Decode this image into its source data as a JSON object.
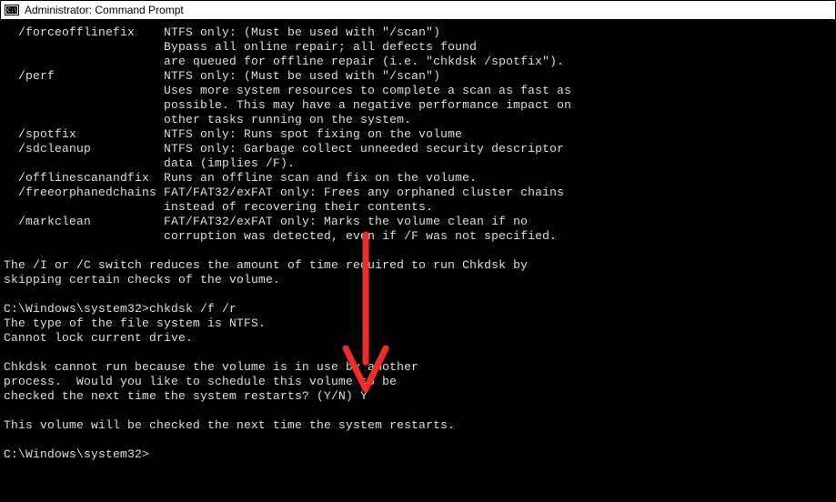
{
  "window": {
    "title": "Administrator: Command Prompt"
  },
  "help": {
    "opt_forceofflinefix": "  /forceofflinefix    NTFS only: (Must be used with \"/scan\")",
    "opt_forceofflinefix_l2": "                      Bypass all online repair; all defects found",
    "opt_forceofflinefix_l3": "                      are queued for offline repair (i.e. \"chkdsk /spotfix\").",
    "opt_perf": "  /perf               NTFS only: (Must be used with \"/scan\")",
    "opt_perf_l2": "                      Uses more system resources to complete a scan as fast as",
    "opt_perf_l3": "                      possible. This may have a negative performance impact on",
    "opt_perf_l4": "                      other tasks running on the system.",
    "opt_spotfix": "  /spotfix            NTFS only: Runs spot fixing on the volume",
    "opt_sdcleanup": "  /sdcleanup          NTFS only: Garbage collect unneeded security descriptor",
    "opt_sdcleanup_l2": "                      data (implies /F).",
    "opt_offlinescanandfix": "  /offlinescanandfix  Runs an offline scan and fix on the volume.",
    "opt_freeorphanedchains": "  /freeorphanedchains FAT/FAT32/exFAT only: Frees any orphaned cluster chains",
    "opt_freeorphanedchains_l2": "                      instead of recovering their contents.",
    "opt_markclean": "  /markclean          FAT/FAT32/exFAT only: Marks the volume clean if no",
    "opt_markclean_l2": "                      corruption was detected, even if /F was not specified.",
    "note_l1": "The /I or /C switch reduces the amount of time required to run Chkdsk by",
    "note_l2": "skipping certain checks of the volume."
  },
  "session": {
    "prompt1": "C:\\Windows\\system32>",
    "command1": "chkdsk /f /r",
    "out_fs_type": "The type of the file system is NTFS.",
    "out_cannot_lock": "Cannot lock current drive.",
    "out_inuse_l1": "Chkdsk cannot run because the volume is in use by another",
    "out_inuse_l2": "process.  Would you like to schedule this volume to be",
    "out_inuse_l3": "checked the next time the system restarts? (Y/N) ",
    "answer": "Y",
    "out_scheduled": "This volume will be checked the next time the system restarts.",
    "prompt2": "C:\\Windows\\system32>"
  },
  "annotation": {
    "arrow_color": "#ed2d26"
  }
}
